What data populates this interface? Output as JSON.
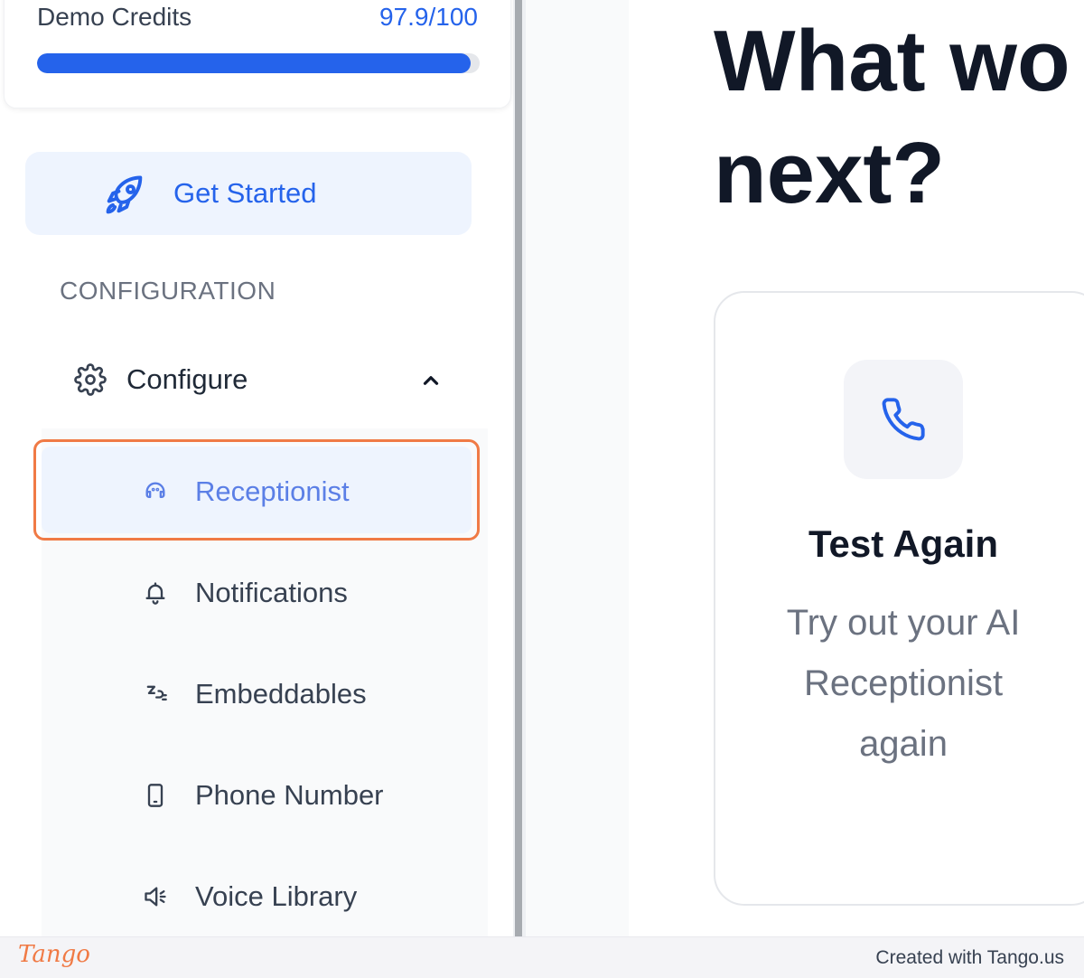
{
  "sidebar": {
    "credits": {
      "label": "Demo Credits",
      "value": "97.9/100",
      "fraction": 0.979
    },
    "get_started": {
      "label": "Get Started",
      "icon": "rocket-icon"
    },
    "section_label": "CONFIGURATION",
    "configure": {
      "label": "Configure",
      "icon": "gear-icon",
      "expanded": true
    },
    "items": [
      {
        "label": "Receptionist",
        "icon": "headset-icon",
        "active": true
      },
      {
        "label": "Notifications",
        "icon": "bell-icon"
      },
      {
        "label": "Embeddables",
        "icon": "plug-icon"
      },
      {
        "label": "Phone Number",
        "icon": "smartphone-icon"
      },
      {
        "label": "Voice Library",
        "icon": "speaker-icon"
      }
    ]
  },
  "main": {
    "heading": "What wo\nnext?",
    "card": {
      "icon": "phone-icon",
      "title": "Test Again",
      "description": "Try out your AI Receptionist again"
    }
  },
  "footer": {
    "logo": "Tango",
    "credit": "Created with Tango.us"
  },
  "colors": {
    "accent": "#2563eb",
    "highlight": "#f07a45"
  }
}
